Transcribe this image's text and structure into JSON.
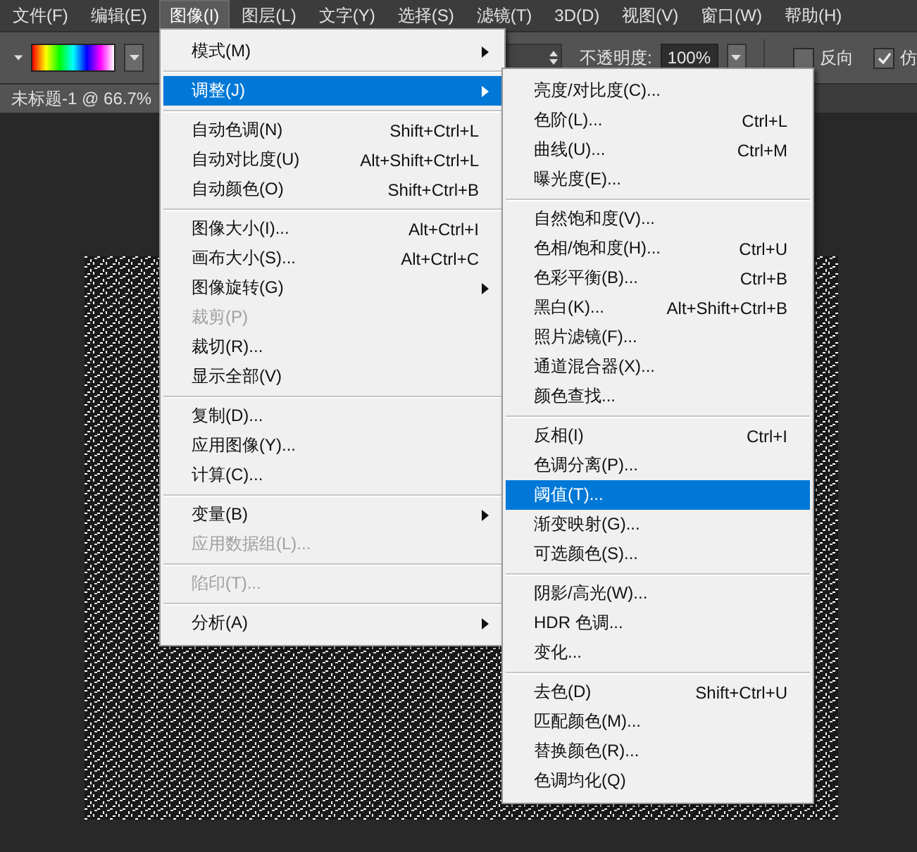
{
  "menu_bar": [
    {
      "label": "文件(F)",
      "selected": false
    },
    {
      "label": "编辑(E)",
      "selected": false
    },
    {
      "label": "图像(I)",
      "selected": true
    },
    {
      "label": "图层(L)",
      "selected": false
    },
    {
      "label": "文字(Y)",
      "selected": false
    },
    {
      "label": "选择(S)",
      "selected": false
    },
    {
      "label": "滤镜(T)",
      "selected": false
    },
    {
      "label": "3D(D)",
      "selected": false
    },
    {
      "label": "视图(V)",
      "selected": false
    },
    {
      "label": "窗口(W)",
      "selected": false
    },
    {
      "label": "帮助(H)",
      "selected": false
    }
  ],
  "options_bar": {
    "opacity_label": "不透明度:",
    "opacity_value": "100%",
    "checkboxes": [
      {
        "label": "反向",
        "checked": false
      },
      {
        "label": "仿",
        "checked": true
      }
    ]
  },
  "document_tab": {
    "title": "未标题-1 @ 66.7%"
  },
  "image_menu": {
    "groups": [
      [
        {
          "label": "模式(M)",
          "has_submenu": true,
          "disabled": false,
          "selected": false
        }
      ],
      [
        {
          "label": "调整(J)",
          "has_submenu": true,
          "disabled": false,
          "selected": true
        }
      ],
      [
        {
          "label": "自动色调(N)",
          "shortcut": "Shift+Ctrl+L",
          "has_submenu": false,
          "disabled": false,
          "selected": false
        },
        {
          "label": "自动对比度(U)",
          "shortcut": "Alt+Shift+Ctrl+L",
          "has_submenu": false,
          "disabled": false,
          "selected": false
        },
        {
          "label": "自动颜色(O)",
          "shortcut": "Shift+Ctrl+B",
          "has_submenu": false,
          "disabled": false,
          "selected": false
        }
      ],
      [
        {
          "label": "图像大小(I)...",
          "shortcut": "Alt+Ctrl+I",
          "has_submenu": false,
          "disabled": false,
          "selected": false
        },
        {
          "label": "画布大小(S)...",
          "shortcut": "Alt+Ctrl+C",
          "has_submenu": false,
          "disabled": false,
          "selected": false
        },
        {
          "label": "图像旋转(G)",
          "has_submenu": true,
          "disabled": false,
          "selected": false
        },
        {
          "label": "裁剪(P)",
          "has_submenu": false,
          "disabled": true,
          "selected": false
        },
        {
          "label": "裁切(R)...",
          "has_submenu": false,
          "disabled": false,
          "selected": false
        },
        {
          "label": "显示全部(V)",
          "has_submenu": false,
          "disabled": false,
          "selected": false
        }
      ],
      [
        {
          "label": "复制(D)...",
          "has_submenu": false,
          "disabled": false,
          "selected": false
        },
        {
          "label": "应用图像(Y)...",
          "has_submenu": false,
          "disabled": false,
          "selected": false
        },
        {
          "label": "计算(C)...",
          "has_submenu": false,
          "disabled": false,
          "selected": false
        }
      ],
      [
        {
          "label": "变量(B)",
          "has_submenu": true,
          "disabled": false,
          "selected": false
        },
        {
          "label": "应用数据组(L)...",
          "has_submenu": false,
          "disabled": true,
          "selected": false
        }
      ],
      [
        {
          "label": "陷印(T)...",
          "has_submenu": false,
          "disabled": true,
          "selected": false
        }
      ],
      [
        {
          "label": "分析(A)",
          "has_submenu": true,
          "disabled": false,
          "selected": false
        }
      ]
    ]
  },
  "adjust_submenu": {
    "groups": [
      [
        {
          "label": "亮度/对比度(C)...",
          "disabled": false,
          "selected": false
        },
        {
          "label": "色阶(L)...",
          "shortcut": "Ctrl+L",
          "disabled": false,
          "selected": false
        },
        {
          "label": "曲线(U)...",
          "shortcut": "Ctrl+M",
          "disabled": false,
          "selected": false
        },
        {
          "label": "曝光度(E)...",
          "disabled": false,
          "selected": false
        }
      ],
      [
        {
          "label": "自然饱和度(V)...",
          "disabled": false,
          "selected": false
        },
        {
          "label": "色相/饱和度(H)...",
          "shortcut": "Ctrl+U",
          "disabled": false,
          "selected": false
        },
        {
          "label": "色彩平衡(B)...",
          "shortcut": "Ctrl+B",
          "disabled": false,
          "selected": false
        },
        {
          "label": "黑白(K)...",
          "shortcut": "Alt+Shift+Ctrl+B",
          "disabled": false,
          "selected": false
        },
        {
          "label": "照片滤镜(F)...",
          "disabled": false,
          "selected": false
        },
        {
          "label": "通道混合器(X)...",
          "disabled": false,
          "selected": false
        },
        {
          "label": "颜色查找...",
          "disabled": false,
          "selected": false
        }
      ],
      [
        {
          "label": "反相(I)",
          "shortcut": "Ctrl+I",
          "disabled": false,
          "selected": false
        },
        {
          "label": "色调分离(P)...",
          "disabled": false,
          "selected": false
        },
        {
          "label": "阈值(T)...",
          "disabled": false,
          "selected": true
        },
        {
          "label": "渐变映射(G)...",
          "disabled": false,
          "selected": false
        },
        {
          "label": "可选颜色(S)...",
          "disabled": false,
          "selected": false
        }
      ],
      [
        {
          "label": "阴影/高光(W)...",
          "disabled": false,
          "selected": false
        },
        {
          "label": "HDR 色调...",
          "disabled": false,
          "selected": false
        },
        {
          "label": "变化...",
          "disabled": false,
          "selected": false
        }
      ],
      [
        {
          "label": "去色(D)",
          "shortcut": "Shift+Ctrl+U",
          "disabled": false,
          "selected": false
        },
        {
          "label": "匹配颜色(M)...",
          "disabled": false,
          "selected": false
        },
        {
          "label": "替换颜色(R)...",
          "disabled": false,
          "selected": false
        },
        {
          "label": "色调均化(Q)",
          "disabled": false,
          "selected": false
        }
      ]
    ]
  }
}
